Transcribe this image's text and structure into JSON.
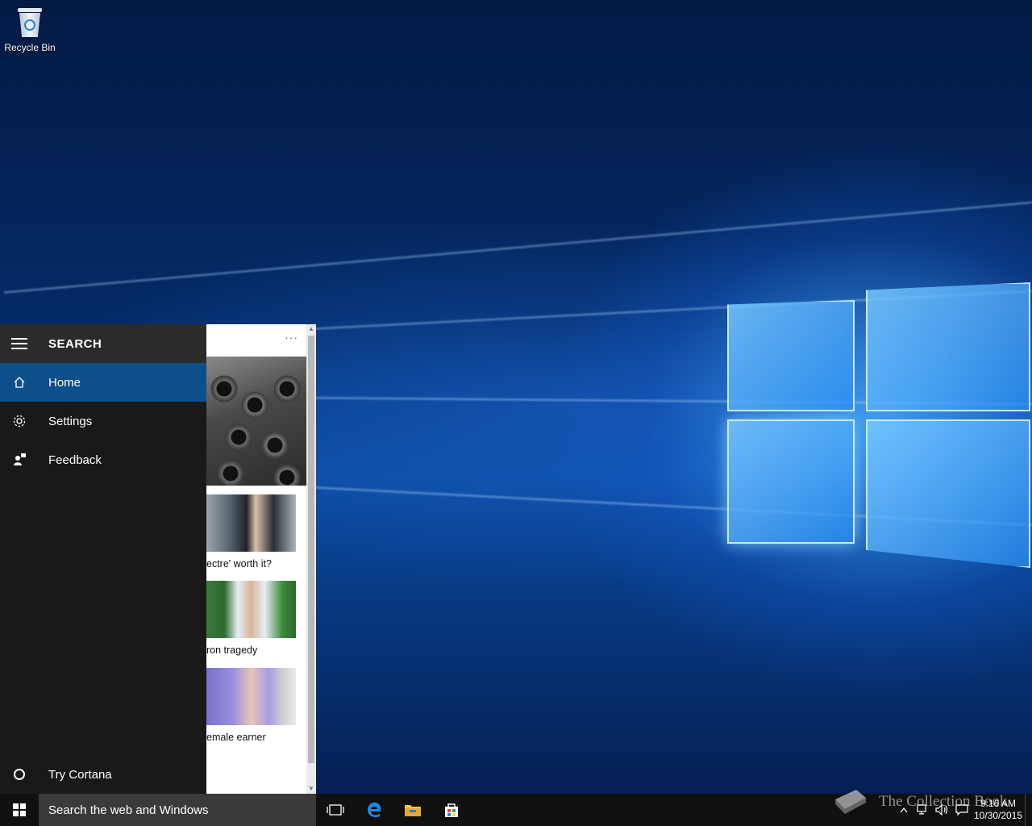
{
  "desktop": {
    "icons": [
      {
        "label": "Recycle Bin"
      }
    ]
  },
  "search_panel": {
    "title": "SEARCH",
    "nav_items": [
      {
        "label": "Home",
        "icon": "home-icon",
        "selected": true
      },
      {
        "label": "Settings",
        "icon": "gear-icon",
        "selected": false
      },
      {
        "label": "Feedback",
        "icon": "feedback-icon",
        "selected": false
      }
    ],
    "bottom_item": {
      "label": "Try Cortana",
      "icon": "circle-icon"
    },
    "accent_color": "#0d4f8b"
  },
  "feed": {
    "more_label": "···",
    "captions": [
      "ectre' worth it?",
      "ron tragedy",
      "emale earner"
    ]
  },
  "taskbar": {
    "search_placeholder": "Search the web and Windows",
    "pinned": [
      "task-view-icon",
      "edge-icon",
      "file-explorer-icon",
      "store-icon"
    ],
    "clock_time": "9:16 AM",
    "clock_date": "10/30/2015"
  },
  "watermark": {
    "text": "The Collection Book"
  }
}
